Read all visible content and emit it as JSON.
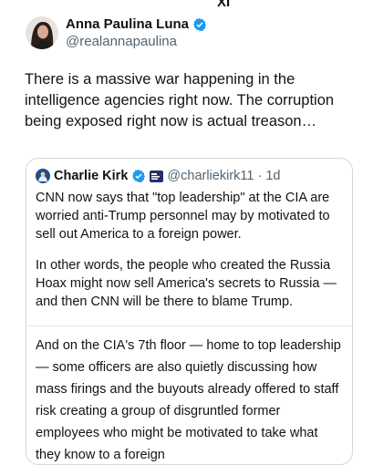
{
  "top_glyph": "XI",
  "author": {
    "name": "Anna Paulina Luna",
    "handle": "@realannapaulina",
    "verified_color": "#1d9bf0"
  },
  "tweet": {
    "text": "There is a massive war happening in the intelligence agencies right now. The corruption being exposed right now is actual treason…"
  },
  "quote": {
    "name": "Charlie Kirk",
    "handle_time": "@charliekirk11 · 1d",
    "paragraphs": [
      "CNN now says that \"top leadership\" at the CIA are worried anti-Trump personnel may by motivated to sell out America to a foreign power.",
      "In other words, the people who created the Russia Hoax might now sell America's secrets to Russia — and then CNN will be there to blame Trump."
    ],
    "embedded_text": "And on the CIA's 7th floor — home to top leadership — some officers are also quietly discussing how mass firings and the buyouts already offered to staff risk creating a group of disgruntled former employees who might be motivated to take what they know to a foreign"
  },
  "icons": {
    "verified": "verified-badge-icon",
    "affiliate": "affiliate-badge-icon"
  }
}
